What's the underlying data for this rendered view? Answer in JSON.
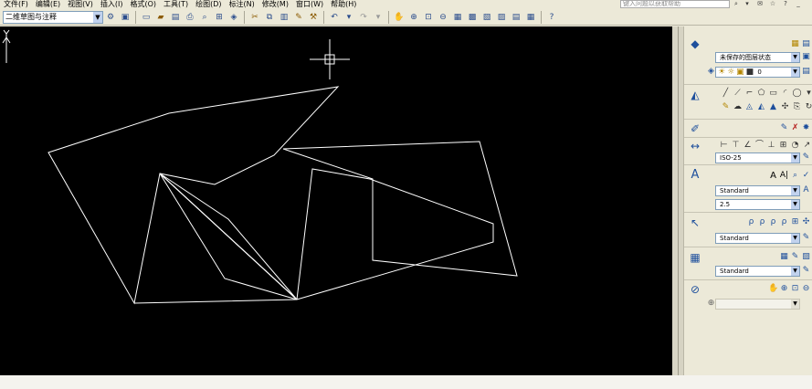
{
  "menubar": {
    "items": [
      "文件(F)",
      "编辑(E)",
      "视图(V)",
      "插入(I)",
      "格式(O)",
      "工具(T)",
      "绘图(D)",
      "标注(N)",
      "修改(M)",
      "窗口(W)",
      "帮助(H)"
    ],
    "help_search_placeholder": "键入问题以获取帮助"
  },
  "toolbar": {
    "workspace_value": "二维草图与注释"
  },
  "panel": {
    "layer_state": "未保存的图层状态",
    "layer_current": "0",
    "dim_style": "ISO-25",
    "text_style": "Standard",
    "text_height": "2.5",
    "mleader_style": "Standard",
    "table_style": "Standard"
  }
}
